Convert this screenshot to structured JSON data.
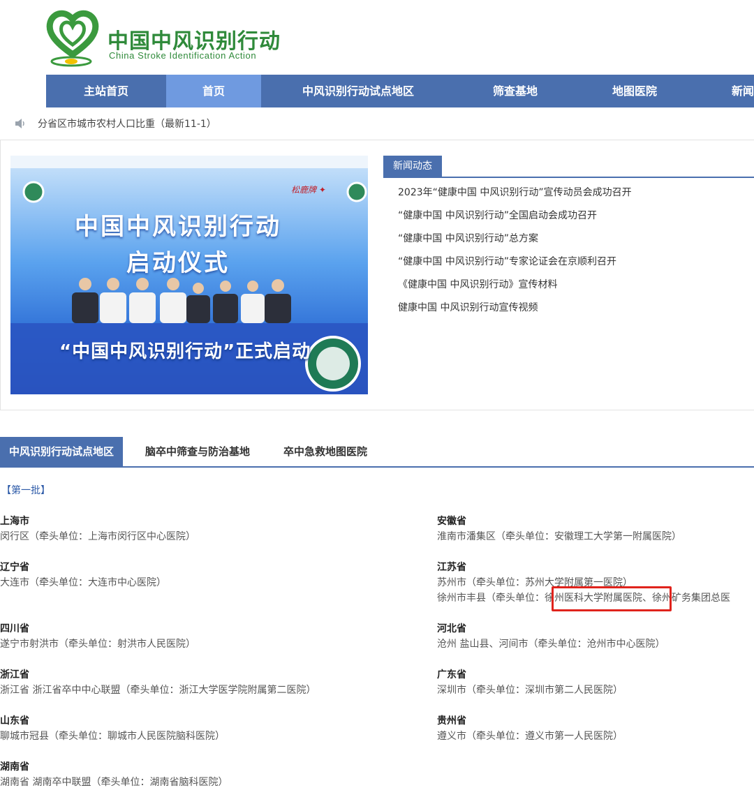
{
  "header": {
    "logo_cn": "中国中风识别行动",
    "logo_en": "China Stroke Identification Action"
  },
  "nav": {
    "items": [
      {
        "label": "主站首页"
      },
      {
        "label": "首页"
      },
      {
        "label": "中风识别行动试点地区"
      },
      {
        "label": "筛查基地"
      },
      {
        "label": "地图医院"
      },
      {
        "label": "新闻"
      }
    ]
  },
  "notice": {
    "text": "分省区市城市农村人口比重（最新11-1）"
  },
  "banner": {
    "title_line1": "中国中风识别行动",
    "title_line2": "启动仪式",
    "bottom_text": "“中国中风识别行动”正式启动"
  },
  "news": {
    "tab_label": "新闻动态",
    "items": [
      "2023年“健康中国 中风识别行动”宣传动员会成功召开",
      "“健康中国 中风识别行动”全国启动会成功召开",
      "“健康中国 中风识别行动”总方案",
      "“健康中国 中风识别行动”专家论证会在京顺利召开",
      "《健康中国 中风识别行动》宣传材料",
      "健康中国 中风识别行动宣传视频"
    ]
  },
  "tabs": [
    {
      "label": "中风识别行动试点地区"
    },
    {
      "label": "脑卒中筛查与防治基地"
    },
    {
      "label": "卒中急救地图医院"
    }
  ],
  "batch_label": "【第一批】",
  "regions_left": [
    {
      "province": "上海市",
      "lines": [
        "闵行区（牵头单位：上海市闵行区中心医院）"
      ]
    },
    {
      "province": "辽宁省",
      "lines": [
        "大连市（牵头单位：大连市中心医院）"
      ]
    },
    {
      "province": "四川省",
      "lines": [
        "遂宁市射洪市（牵头单位：射洪市人民医院）"
      ]
    },
    {
      "province": "浙江省",
      "lines": [
        "浙江省 浙江省卒中中心联盟（牵头单位：浙江大学医学院附属第二医院）"
      ]
    },
    {
      "province": "山东省",
      "lines": [
        "聊城市冠县（牵头单位：聊城市人民医院脑科医院）"
      ]
    },
    {
      "province": "湖南省",
      "lines": [
        "湖南省 湖南卒中联盟（牵头单位：湖南省脑科医院）"
      ]
    }
  ],
  "regions_right": [
    {
      "province": "安徽省",
      "lines": [
        "淮南市潘集区（牵头单位：安徽理工大学第一附属医院）"
      ]
    },
    {
      "province": "江苏省",
      "lines": [
        "苏州市（牵头单位：苏州大学附属第一医院）",
        "徐州市丰县（牵头单位：徐州医科大学附属医院、徐州矿务集团总医"
      ]
    },
    {
      "province": "河北省",
      "lines": [
        "沧州 盐山县、河间市（牵头单位：沧州市中心医院）"
      ]
    },
    {
      "province": "广东省",
      "lines": [
        "深圳市（牵头单位：深圳市第二人民医院）"
      ]
    },
    {
      "province": "贵州省",
      "lines": [
        "遵义市（牵头单位：遵义市第一人民医院）"
      ]
    }
  ]
}
